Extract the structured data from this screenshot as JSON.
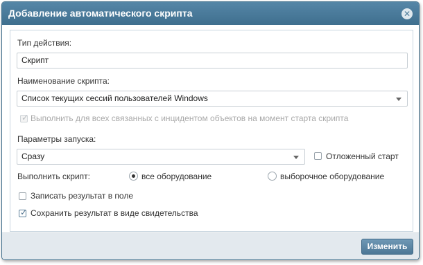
{
  "dialog": {
    "title": "Добавление автоматического скрипта",
    "close_icon": "close-icon"
  },
  "form": {
    "action_type_label": "Тип действия:",
    "action_type_value": "Скрипт",
    "script_name_label": "Наименование скрипта:",
    "script_name_value": "Список текущих сессий пользователей Windows",
    "run_for_all_label": "Выполнить для всех связанных с инцидентом объектов на момент старта скрипта",
    "run_for_all_checked": true,
    "run_for_all_disabled": true,
    "launch_params_label": "Параметры запуска:",
    "launch_params_value": "Сразу",
    "deferred_start_label": "Отложенный старт",
    "deferred_start_checked": false,
    "execute_label": "Выполнить скрипт:",
    "radio_all_label": "все оборудование",
    "radio_all_selected": true,
    "radio_selective_label": "выборочное оборудование",
    "radio_selective_selected": false,
    "write_result_label": "Записать результат в поле",
    "write_result_checked": false,
    "save_evidence_label": "Сохранить результат в виде свидетельства",
    "save_evidence_checked": true
  },
  "footer": {
    "change_button": "Изменить"
  },
  "colors": {
    "titlebar": "#4a7a99",
    "button": "#5c86a4",
    "footer": "#e3e9ee"
  }
}
